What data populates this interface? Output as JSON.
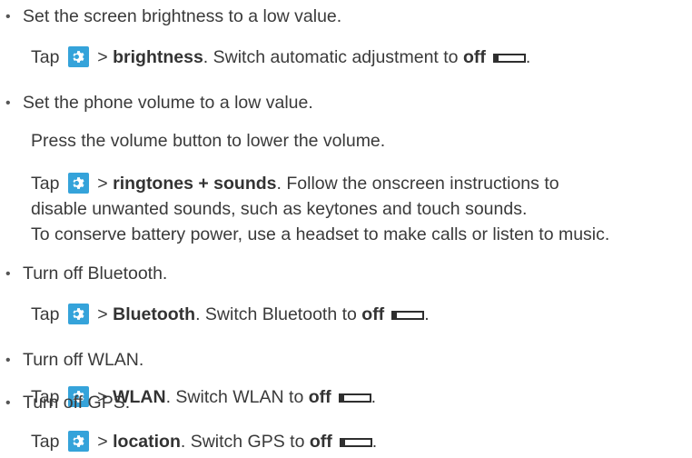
{
  "items": [
    {
      "bullet": "Set the screen brightness to a low value.",
      "steps": [
        {
          "tap": "Tap",
          "gt": ">",
          "bold": "brightness",
          "rest": ". Switch automatic adjustment to ",
          "off": "off",
          "end": "."
        }
      ]
    },
    {
      "bullet": "Set the phone volume to a low value.",
      "press": "Press the volume button to lower the volume.",
      "steps": [
        {
          "tap": "Tap",
          "gt": ">",
          "bold": "ringtones + sounds",
          "rest": ". Follow the onscreen instructions to"
        }
      ],
      "lines": [
        "disable unwanted sounds, such as keytones and touch sounds.",
        "To conserve battery power, use a headset to make calls or listen to music."
      ]
    },
    {
      "bullet": "Turn off Bluetooth.",
      "steps": [
        {
          "tap": "Tap",
          "gt": ">",
          "bold": "Bluetooth",
          "rest": ". Switch Bluetooth to ",
          "off": "off",
          "end": "."
        }
      ]
    },
    {
      "bullet": "Turn off WLAN.",
      "steps": [
        {
          "tap": "Tap",
          "gt": ">",
          "bold": "WLAN",
          "rest": ". Switch WLAN to ",
          "off": "off",
          "end": "."
        }
      ]
    },
    {
      "bullet": "Turn off GPS.",
      "steps": [
        {
          "tap": "Tap",
          "gt": ">",
          "bold": "location",
          "rest": ". Switch GPS to ",
          "off": "off",
          "end": "."
        }
      ]
    }
  ],
  "icons": {
    "settings": "settings-gear-icon",
    "toggle": "toggle-off-icon"
  },
  "colors": {
    "settings_icon_bg": "#35a3da",
    "text": "#3a3a3a"
  }
}
